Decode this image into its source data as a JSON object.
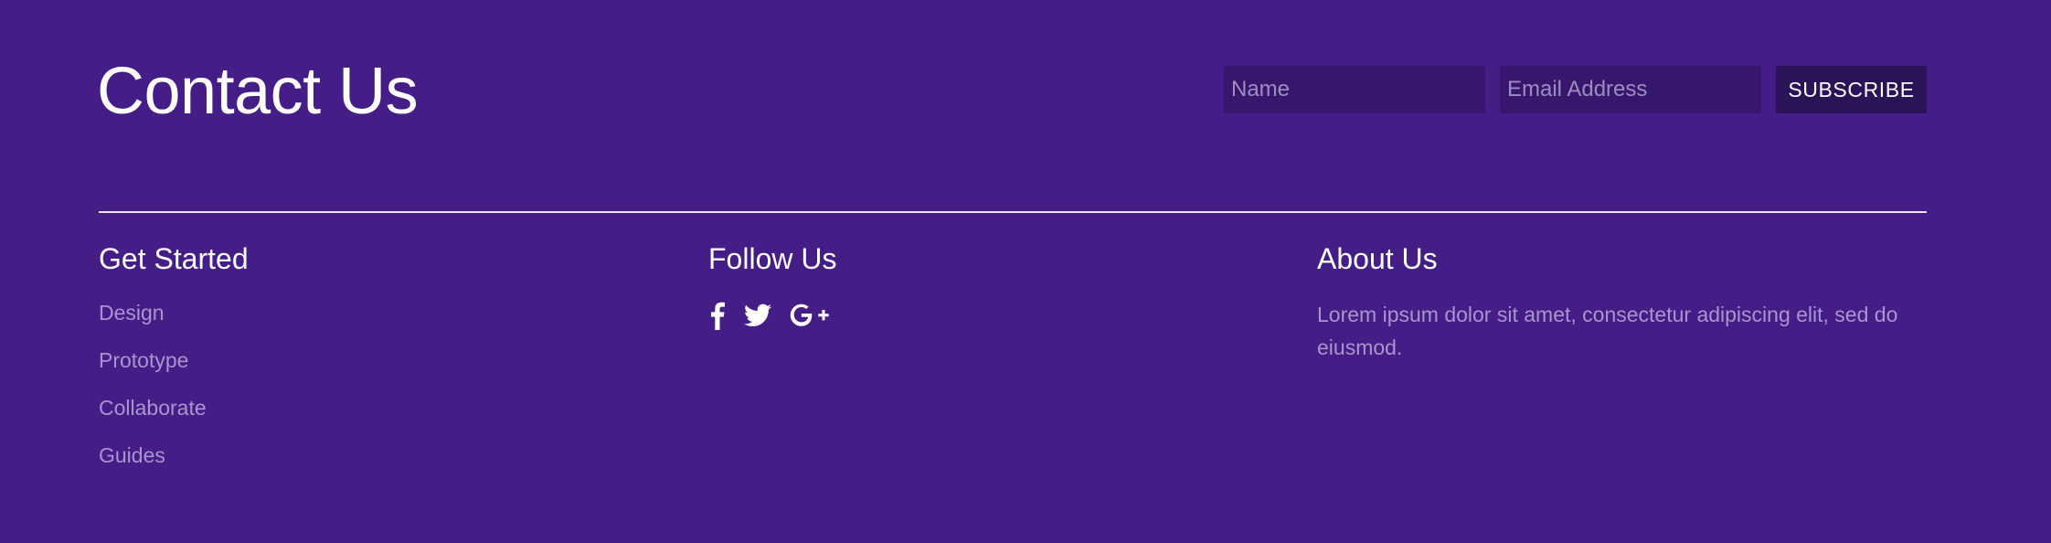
{
  "contact": {
    "title": "Contact Us"
  },
  "subscribe_form": {
    "name_placeholder": "Name",
    "email_placeholder": "Email Address",
    "button_label": "SUBSCRIBE"
  },
  "columns": {
    "get_started": {
      "heading": "Get Started",
      "links": [
        "Design",
        "Prototype",
        "Collaborate",
        "Guides"
      ]
    },
    "follow_us": {
      "heading": "Follow Us",
      "icons": [
        "facebook-icon",
        "twitter-icon",
        "google-plus-icon"
      ]
    },
    "about_us": {
      "heading": "About Us",
      "text": "Lorem ipsum dolor sit amet, consectetur adipiscing elit, sed do eiusmod."
    }
  },
  "colors": {
    "background": "#441d86",
    "input_background": "#37166e",
    "button_background": "#2a1356",
    "muted_text": "#a895cf",
    "heading_text": "#ffffff"
  }
}
